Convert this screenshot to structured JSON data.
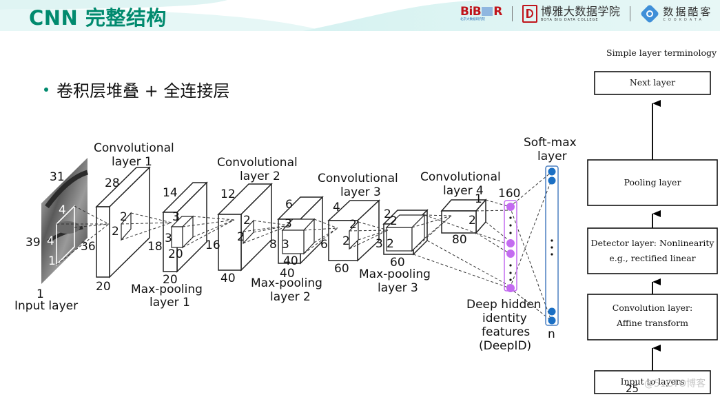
{
  "header": {
    "title": "CNN 完整结构",
    "logos": {
      "bibdr": {
        "mark_left": "BiB",
        "mark_right": "R",
        "sub": "北京大数据研究院"
      },
      "boya": {
        "cn": "博雅大数据学院",
        "en": "BOYA BIG DATA COLLEGE"
      },
      "cookdata": {
        "cn": "数据酷客",
        "en": "COOKDATA"
      }
    }
  },
  "bullet": {
    "text": "卷积层堆叠 + 全连接层"
  },
  "diagram": {
    "input_layer": {
      "name": "Input layer",
      "height": "39",
      "width": "31",
      "depth": "1",
      "filter_h": "4",
      "filter_w": "4",
      "filter_d": "1"
    },
    "conv1": {
      "title_line1": "Convolutional",
      "title_line2": "layer 1",
      "height": "36",
      "width": "28",
      "depth": "20",
      "filter_h": "2",
      "filter_w": "2"
    },
    "pool1": {
      "title_line1": "Max-pooling",
      "title_line2": "layer 1",
      "height": "18",
      "width": "14",
      "depth": "20",
      "filter_h": "3",
      "filter_w": "3",
      "filter_d": "20"
    },
    "conv2": {
      "title_line1": "Convolutional",
      "title_line2": "layer 2",
      "height": "16",
      "width": "12",
      "depth": "40",
      "filter_h": "2",
      "filter_w": "2"
    },
    "pool2": {
      "title_line1": "Max-pooling",
      "title_line2": "layer 2",
      "height": "8",
      "width": "6",
      "depth": "40",
      "filter_h": "3",
      "filter_w": "3",
      "filter_d": "40"
    },
    "conv3": {
      "title_line1": "Convolutional",
      "title_line2": "layer 3",
      "height": "6",
      "width": "4",
      "depth": "60",
      "filter_h": "2",
      "filter_w": "2"
    },
    "pool3": {
      "title_line1": "Max-pooling",
      "title_line2": "layer 3",
      "height": "3",
      "width": "2",
      "depth": "60",
      "filter_h": "2",
      "filter_w": "2"
    },
    "conv4": {
      "title_line1": "Convolutional",
      "title_line2": "layer 4",
      "height": "2",
      "width": "1",
      "depth": "80"
    },
    "deepid": {
      "count": "160",
      "line1": "Deep hidden",
      "line2": "identity",
      "line3": "features",
      "line4": "(DeepID)",
      "color": "#c36bf0"
    },
    "softmax": {
      "title_line1": "Soft-max",
      "title_line2": "layer",
      "count": "n",
      "color": "#1a6fc4"
    },
    "terminology": {
      "title": "Simple layer terminology",
      "boxes": [
        {
          "line1": "Next layer",
          "line2": ""
        },
        {
          "line1": "Pooling layer",
          "line2": ""
        },
        {
          "line1": "Detector layer: Nonlinearity",
          "line2": "e.g., rectified linear"
        },
        {
          "line1": "Convolution layer:",
          "line2": "Affine transform"
        },
        {
          "line1": "Input to layers",
          "line2": ""
        }
      ]
    }
  },
  "footer": {
    "page": "25",
    "watermark": "@51CTO博客"
  },
  "colors": {
    "accent": "#008a6e",
    "header_wave": "#d3f1f0",
    "deepid": "#c36bf0",
    "softmax": "#1a6fc4"
  }
}
